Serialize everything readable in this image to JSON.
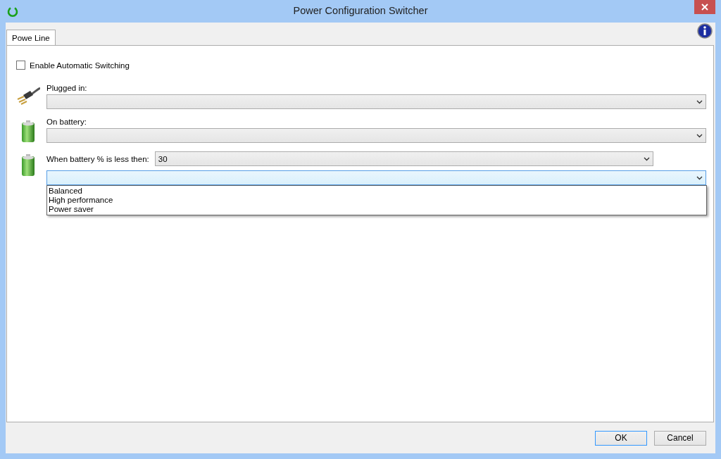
{
  "window": {
    "title": "Power Configuration Switcher"
  },
  "tabs": [
    {
      "label": "Powe Line",
      "selected": true
    }
  ],
  "auto_switching": {
    "label": "Enable Automatic Switching",
    "checked": false
  },
  "profiles": [
    {
      "kind": "plug",
      "label": "Plugged in:"
    },
    {
      "kind": "battery",
      "label": "On battery:"
    }
  ],
  "threshold": {
    "label": "When battery %  is less then:",
    "value": "30",
    "expanded": true,
    "options": [
      "Balanced",
      "High performance",
      "Power saver"
    ]
  },
  "buttons": [
    {
      "label": "OK",
      "default": true
    },
    {
      "label": "Cancel",
      "default": false
    }
  ]
}
